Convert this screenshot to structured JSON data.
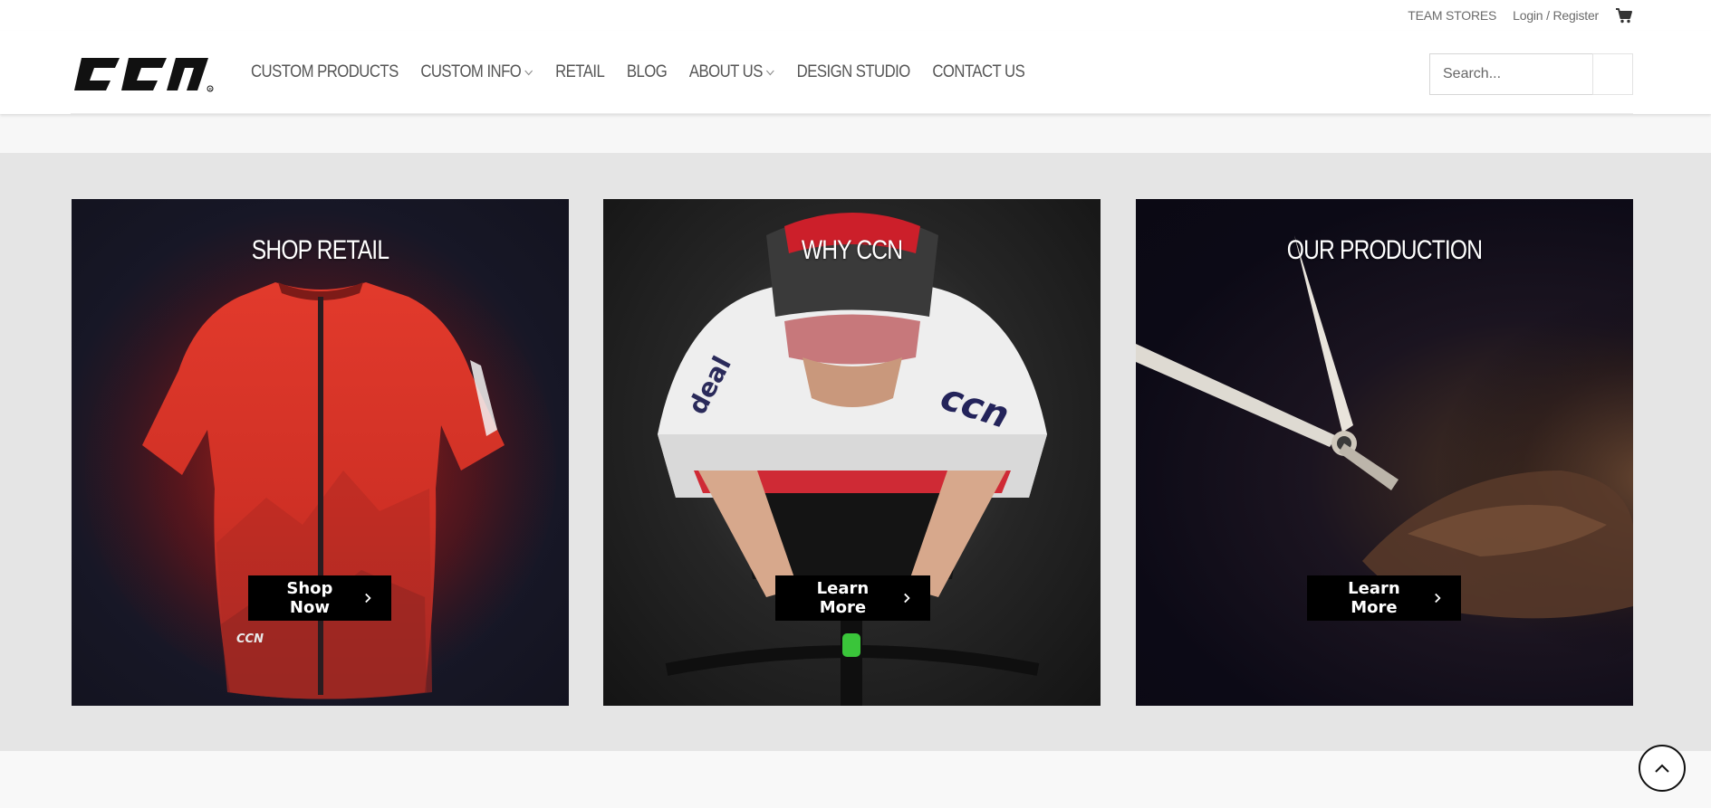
{
  "topbar": {
    "team_stores": "TEAM STORES",
    "login_register": "Login / Register",
    "cart_icon": "cart-icon"
  },
  "header": {
    "logo_text": "CCN",
    "nav": [
      {
        "label": "CUSTOM PRODUCTS",
        "has_dropdown": false
      },
      {
        "label": "CUSTOM INFO",
        "has_dropdown": true
      },
      {
        "label": "RETAIL",
        "has_dropdown": false
      },
      {
        "label": "BLOG",
        "has_dropdown": false
      },
      {
        "label": "ABOUT US",
        "has_dropdown": true
      },
      {
        "label": "DESIGN STUDIO",
        "has_dropdown": false
      },
      {
        "label": "CONTACT US",
        "has_dropdown": false
      }
    ],
    "search": {
      "placeholder": "Search...",
      "value": "",
      "icon": "search-icon"
    }
  },
  "cards": [
    {
      "title": "SHOP RETAIL",
      "button": "Shop Now",
      "image": "red-cycling-jersey"
    },
    {
      "title": "WHY CCN",
      "button": "Learn More",
      "image": "cyclist-on-bike"
    },
    {
      "title": "OUR PRODUCTION",
      "button": "Learn More",
      "image": "scissors-in-hand"
    }
  ],
  "colors": {
    "accent": "#000000",
    "band": "#e5e5e5",
    "nav_text": "#555555"
  },
  "back_to_top_icon": "chevron-up-icon"
}
